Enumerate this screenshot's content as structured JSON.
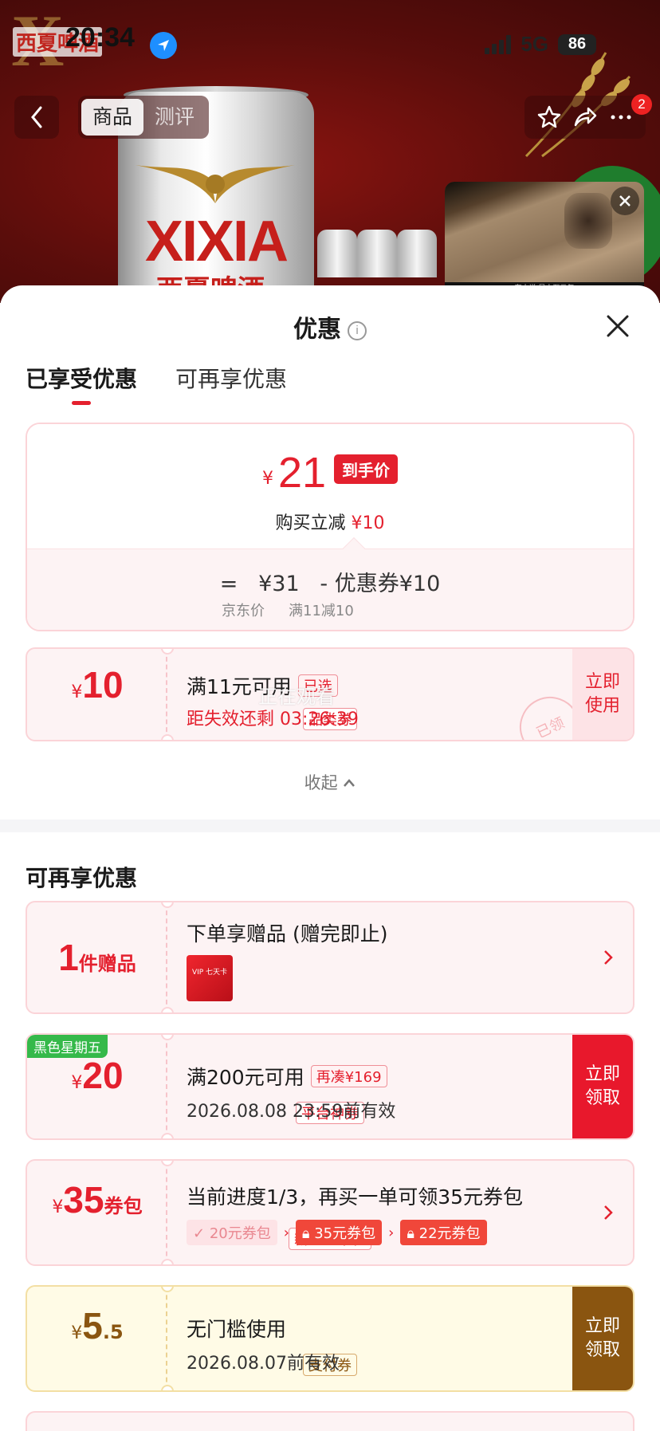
{
  "status_bar": {
    "time": "20:34",
    "network": "5G",
    "battery": "86"
  },
  "hero": {
    "brand_logo": "西夏啤酒",
    "can_text": "XIXIA",
    "can_sub": "西夏啤酒"
  },
  "nav": {
    "tabs": [
      "商品",
      "测评"
    ],
    "active_tab": "商品",
    "cart_badge": "2",
    "icons": [
      "back-icon",
      "star-icon",
      "share-icon",
      "more-icon"
    ]
  },
  "video": {
    "caption": "有人说 是十万元年"
  },
  "sheet": {
    "title": "优惠",
    "info_glyph": "i",
    "tabs": [
      "已享受优惠",
      "可再享优惠"
    ],
    "price_card": {
      "currency": "¥",
      "final_price": "21",
      "final_tag": "到手价",
      "reduce_label": "购买立减",
      "reduce_amount": "¥10",
      "formula": {
        "eq": "=",
        "base": "¥31",
        "minus": "-",
        "coupon": "优惠券¥10",
        "base_label": "京东价",
        "coupon_label": "满11减10"
      }
    },
    "applied_coupon": {
      "currency": "¥",
      "amount": "10",
      "type": "品类券",
      "title": "满11元可用",
      "status_pill": "已选",
      "overlay": "正在观看",
      "countdown_label": "距失效还剩",
      "countdown": "03:26:39",
      "action": "立即使用",
      "stamp": "已领"
    },
    "collapse_label": "收起",
    "more_section_title": "可再享优惠",
    "offers": [
      {
        "kind": "gift",
        "count": "1",
        "unit": "件赠品",
        "title": "下单享赠品 (赠完即止)",
        "gift_card": "VIP 七天卡"
      },
      {
        "kind": "coupon",
        "hot_tag": "黑色星期五",
        "currency": "¥",
        "amount": "20",
        "type": "平台神券",
        "title": "满200元可用",
        "pill": "再凑¥169",
        "sub": "2026.08.08 23:59前有效",
        "action": "立即领取"
      },
      {
        "kind": "package",
        "currency": "¥",
        "amount": "35",
        "unit": "券包",
        "type": "新人三单礼",
        "title": "当前进度1/3，再买一单可领35元券包",
        "steps": [
          "20元券包",
          "35元券包",
          "22元券包"
        ]
      },
      {
        "kind": "payment",
        "currency": "¥",
        "amount": "5",
        "decimal": ".5",
        "type": "支付券",
        "title": "无门槛使用",
        "sub": "2026.08.07前有效",
        "action": "立即领取"
      }
    ]
  }
}
